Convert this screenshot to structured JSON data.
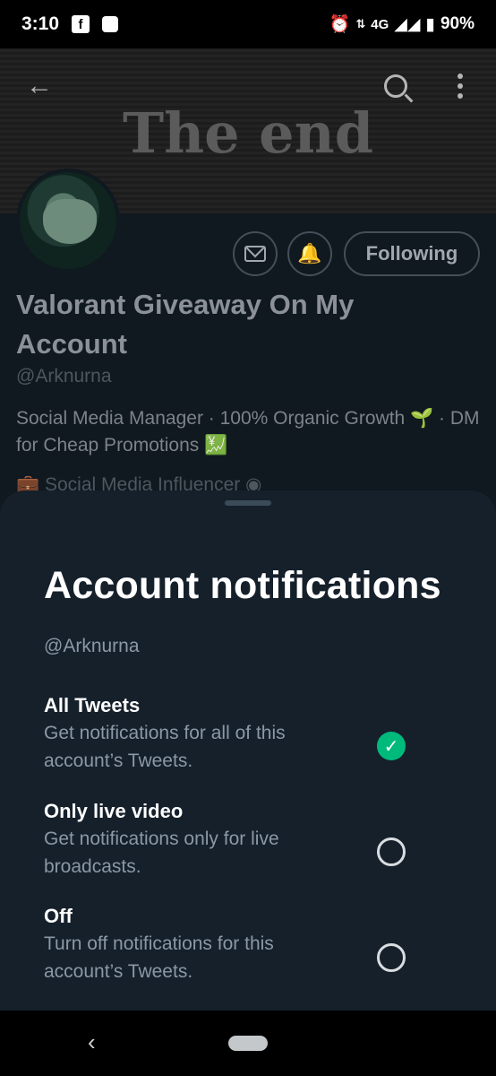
{
  "status_bar": {
    "time": "3:10",
    "network": "4G",
    "battery": "90%",
    "icons": [
      "facebook-icon",
      "app-square-icon",
      "alarm-icon",
      "data-arrows-icon",
      "signal-icon",
      "battery-icon"
    ]
  },
  "profile": {
    "banner_text": "The end",
    "display_name": "Valorant Giveaway On My Account",
    "handle": "@Arknurna",
    "bio": "Social Media Manager · 100% Organic Growth 🌱 · DM for Cheap Promotions 💹",
    "meta": "Social Media Influencer",
    "following_label": "Following"
  },
  "sheet": {
    "title": "Account notifications",
    "handle": "@Arknurna",
    "options": [
      {
        "title": "All Tweets",
        "description": "Get notifications for all of this account’s Tweets.",
        "selected": true
      },
      {
        "title": "Only live video",
        "description": "Get notifications only for live broadcasts.",
        "selected": false
      },
      {
        "title": "Off",
        "description": "Turn off notifications for this account’s Tweets.",
        "selected": false
      }
    ]
  },
  "colors": {
    "sheet_bg": "#15202b",
    "accent_green": "#00ba7c",
    "secondary_text": "#8b98a5"
  }
}
